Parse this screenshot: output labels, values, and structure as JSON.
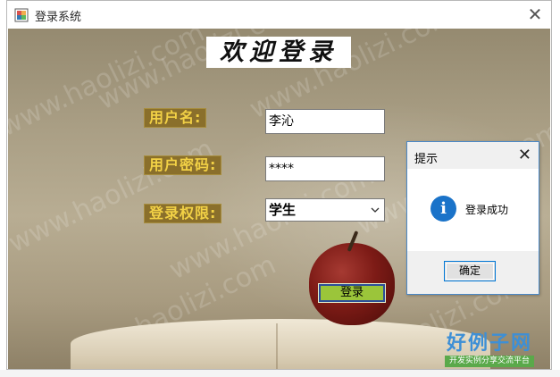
{
  "window": {
    "title": "登录系统",
    "close_glyph": "✕"
  },
  "form": {
    "welcome": "欢迎登录",
    "username_label": "用户名:",
    "password_label": "用户密码:",
    "role_label": "登录权限:",
    "username_value": "李沁",
    "password_value": "****",
    "role_value": "学生",
    "login_button": "登录"
  },
  "dialog": {
    "title": "提示",
    "close_glyph": "✕",
    "message": "登录成功",
    "ok_button": "确定",
    "icon": "info-icon"
  },
  "watermark": {
    "text": "www.haolizi.com"
  },
  "logo": {
    "main": "好例子网",
    "sub": "开发实例分享交流平台"
  },
  "colors": {
    "label_bg": "#8a6f2b",
    "label_text": "#f2d146",
    "login_button_bg": "#9bc53a",
    "dialog_border": "#4a88c7",
    "info_icon": "#1a73c9"
  },
  "icons": {
    "app": "app-icon",
    "window_close": "close-icon",
    "select_arrow": "chevron-down-icon"
  }
}
